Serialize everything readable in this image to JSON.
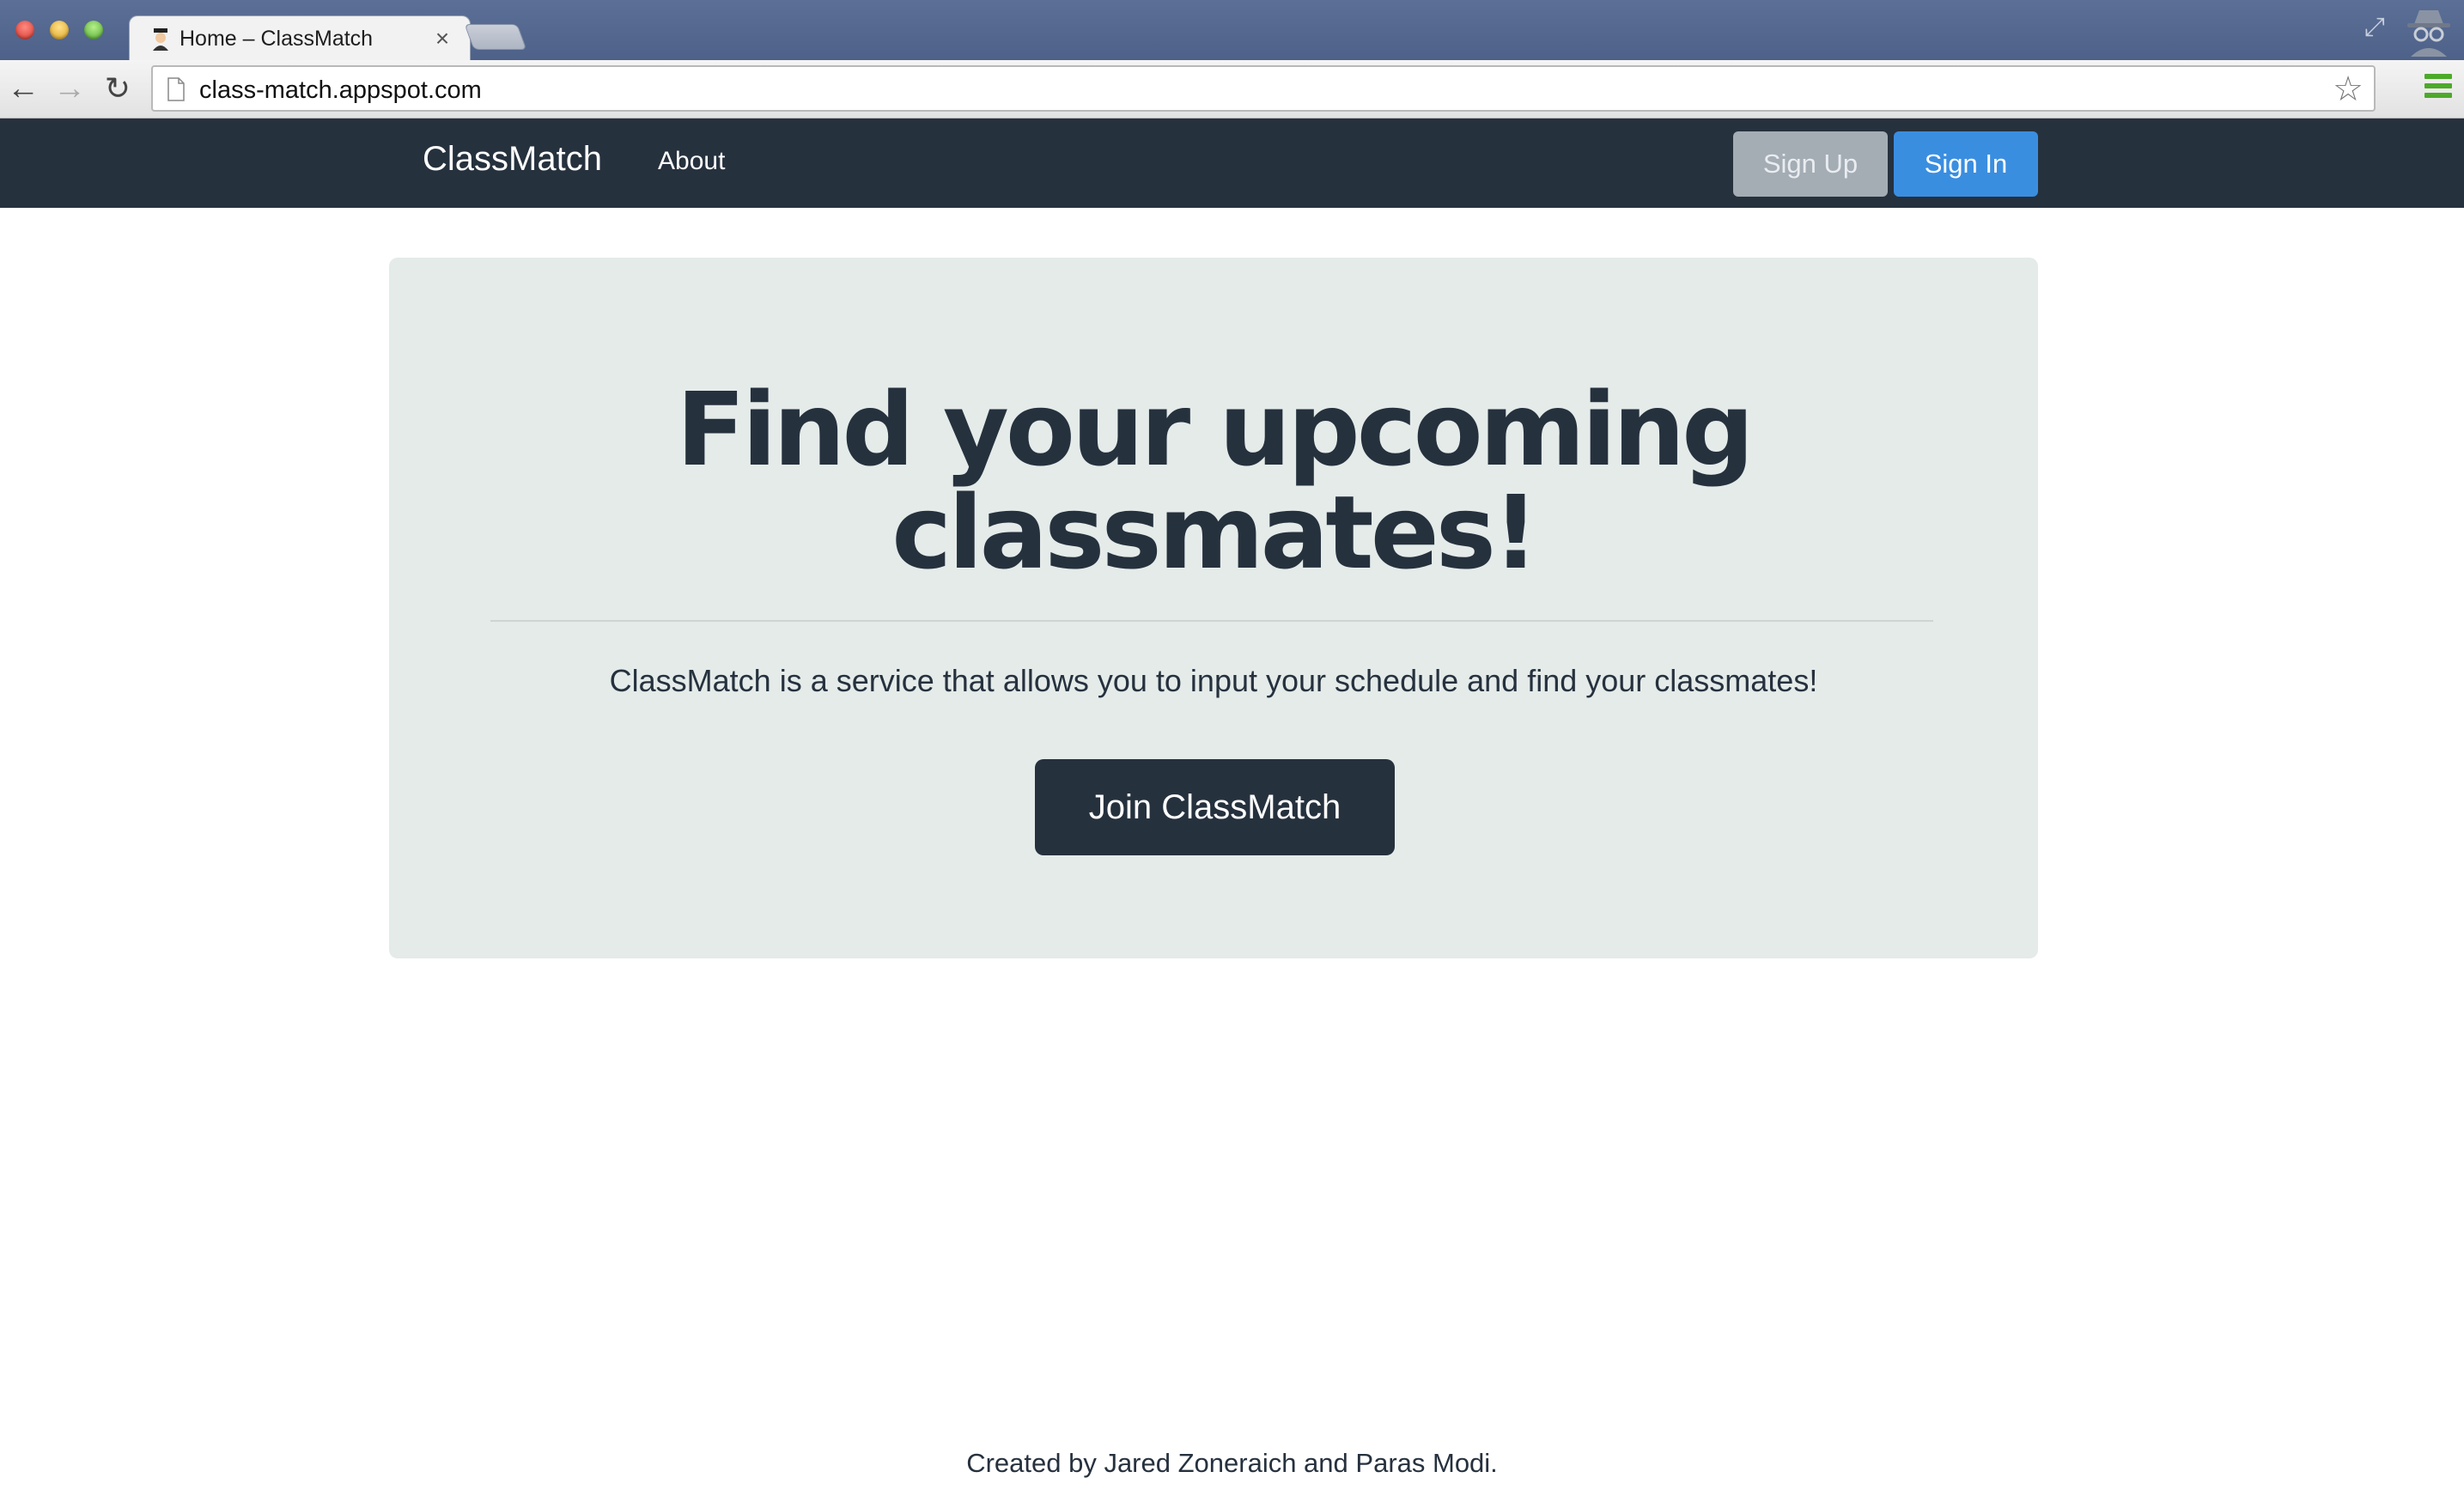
{
  "browser": {
    "tab_title": "Home – ClassMatch",
    "tab_close": "×",
    "url": "class-match.appspot.com",
    "icons": {
      "back": "arrow-left-icon",
      "forward": "arrow-right-icon",
      "reload": "reload-icon",
      "page": "page-icon",
      "star": "star-icon",
      "menu": "menu-icon",
      "incognito": "incognito-icon",
      "expand": "expand-icon"
    }
  },
  "navbar": {
    "brand": "ClassMatch",
    "about": "About",
    "signup": "Sign Up",
    "signin": "Sign In",
    "colors": {
      "background": "#26313e",
      "signin": "#3a8ee0",
      "signup": "#a4acb4"
    }
  },
  "hero": {
    "title_line1": "Find your upcoming",
    "title_line2": "classmates!",
    "description": "ClassMatch is a service that allows you to input your schedule and find your classmates!",
    "cta": "Join ClassMatch",
    "colors": {
      "background": "#e4ebe9",
      "text": "#26313e"
    }
  },
  "footer": {
    "text": "Created by Jared Zoneraich and Paras Modi."
  }
}
